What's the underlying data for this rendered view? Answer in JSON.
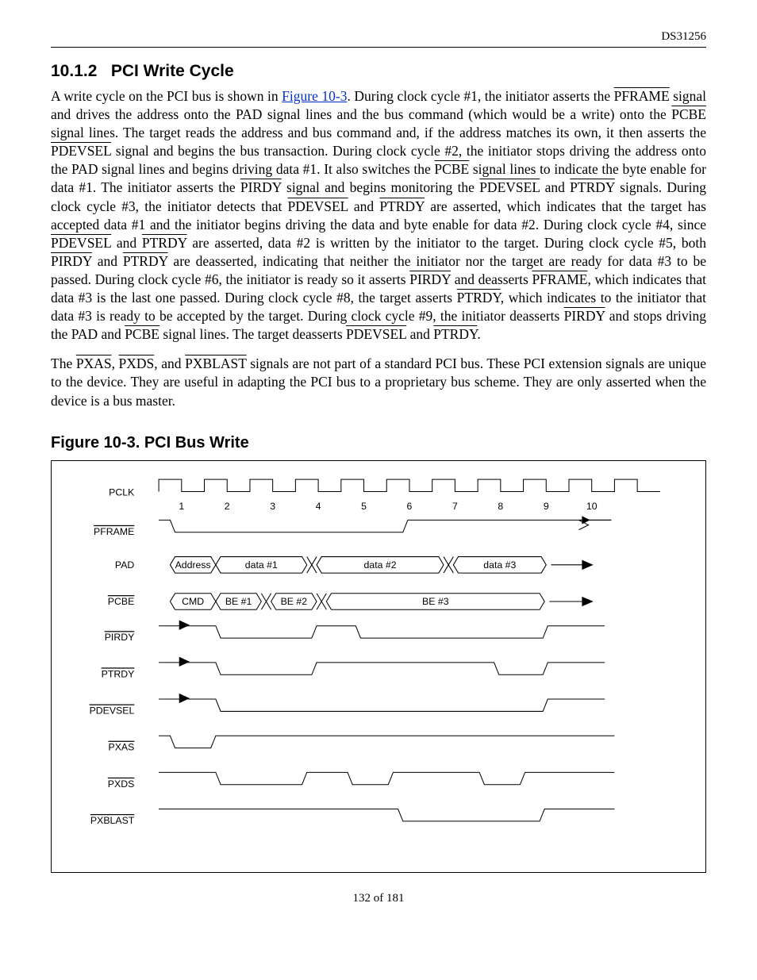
{
  "doc_id": "DS31256",
  "section": {
    "number": "10.1.2",
    "title": "PCI Write Cycle"
  },
  "figure_link_text": "Figure 10-3",
  "figure_title": "Figure 10-3. PCI Bus Write",
  "page_number": "132 of 181",
  "signals": {
    "pclk": "PCLK",
    "pframe": "PFRAME",
    "pad": "PAD",
    "pcbe": "PCBE",
    "pirdy": "PIRDY",
    "ptrdy": "PTRDY",
    "pdevsel": "PDEVSEL",
    "pxas": "PXAS",
    "pxds": "PXDS",
    "pxblast": "PXBLAST"
  },
  "clock_labels": [
    "1",
    "2",
    "3",
    "4",
    "5",
    "6",
    "7",
    "8",
    "9",
    "10"
  ],
  "bus_labels": {
    "address": "Address",
    "data1": "data #1",
    "data2": "data #2",
    "data3": "data #3",
    "cmd": "CMD",
    "be1": "BE #1",
    "be2": "BE #2",
    "be3": "BE #3"
  },
  "body": {
    "p1a": "A write cycle on the PCI bus is shown in ",
    "p1b": ". During clock cycle #1, the initiator asserts the ",
    "p1c": " signal and drives the address onto the PAD signal lines and the bus command (which would be a write) onto the ",
    "p1d": " signal lines. The target reads the address and bus command and, if the address matches its own, it then asserts the ",
    "p1e": " signal and begins the bus transaction. During clock cycle #2, the initiator stops driving the address onto the PAD signal lines and begins driving data #1. It also switches the ",
    "p1f": " signal lines to indicate the byte enable for data #1. The initiator asserts the ",
    "p1g": " signal and begins monitoring the ",
    "p1h": " and ",
    "p1i": " signals. During clock cycle #3, the initiator detects that ",
    "p1j": " and ",
    "p1k": " are asserted, which indicates that the target has accepted data #1 and the initiator begins driving the data and byte enable for data #2. During clock cycle #4, since ",
    "p1l": " and ",
    "p1m": " are asserted, data #2 is written by the initiator to the target. During clock cycle #5, both ",
    "p1n": " and ",
    "p1o": " are deasserted, indicating that neither the initiator nor the target are ready for data #3 to be passed. During clock cycle #6, the initiator is ready so it asserts ",
    "p1p": " and deasserts ",
    "p1q": ", which indicates that data #3 is the last one passed. During clock cycle #8, the target asserts ",
    "p1r": ", which indicates to the initiator that data #3 is ready to be accepted by the target. During clock cycle #9, the initiator deasserts ",
    "p1s": " and stops driving the PAD and ",
    "p1t": " signal lines. The target deasserts ",
    "p1u": " and ",
    "p1v": ".",
    "p2a": "The ",
    "p2b": ", ",
    "p2c": ", and ",
    "p2d": " signals are not part of a standard PCI bus. These PCI extension signals are unique to the device. They are useful in adapting the PCI bus to a proprietary bus scheme. They are only asserted when the device is a bus master."
  }
}
